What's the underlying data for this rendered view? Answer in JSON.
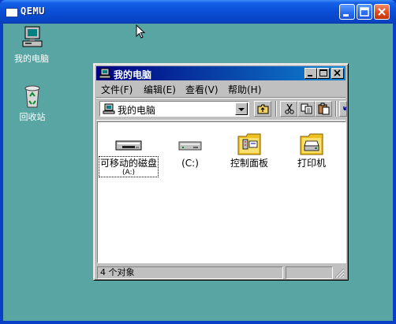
{
  "qemu": {
    "title": "QEMU"
  },
  "desktop": {
    "icons": [
      {
        "label": "我的电脑",
        "icon": "my-computer-icon"
      },
      {
        "label": "回收站",
        "icon": "recycle-bin-icon"
      }
    ]
  },
  "explorer": {
    "title": "我的电脑",
    "menu": [
      "文件(F)",
      "编辑(E)",
      "查看(V)",
      "帮助(H)"
    ],
    "address": "我的电脑",
    "items": [
      {
        "label": "可移动的磁盘",
        "sub": "(A:)",
        "icon": "floppy-drive-icon",
        "selected": true
      },
      {
        "label": "(C:)",
        "sub": "",
        "icon": "hard-drive-icon",
        "selected": false
      },
      {
        "label": "控制面板",
        "sub": "",
        "icon": "control-panel-folder-icon",
        "selected": false
      },
      {
        "label": "打印机",
        "sub": "",
        "icon": "printers-folder-icon",
        "selected": false
      }
    ],
    "status": "4 个对象"
  },
  "colors": {
    "desktop": "#58a5a3",
    "title_start": "#000080",
    "title_end": "#1084d0",
    "xp_title": "#0a4ed6"
  }
}
